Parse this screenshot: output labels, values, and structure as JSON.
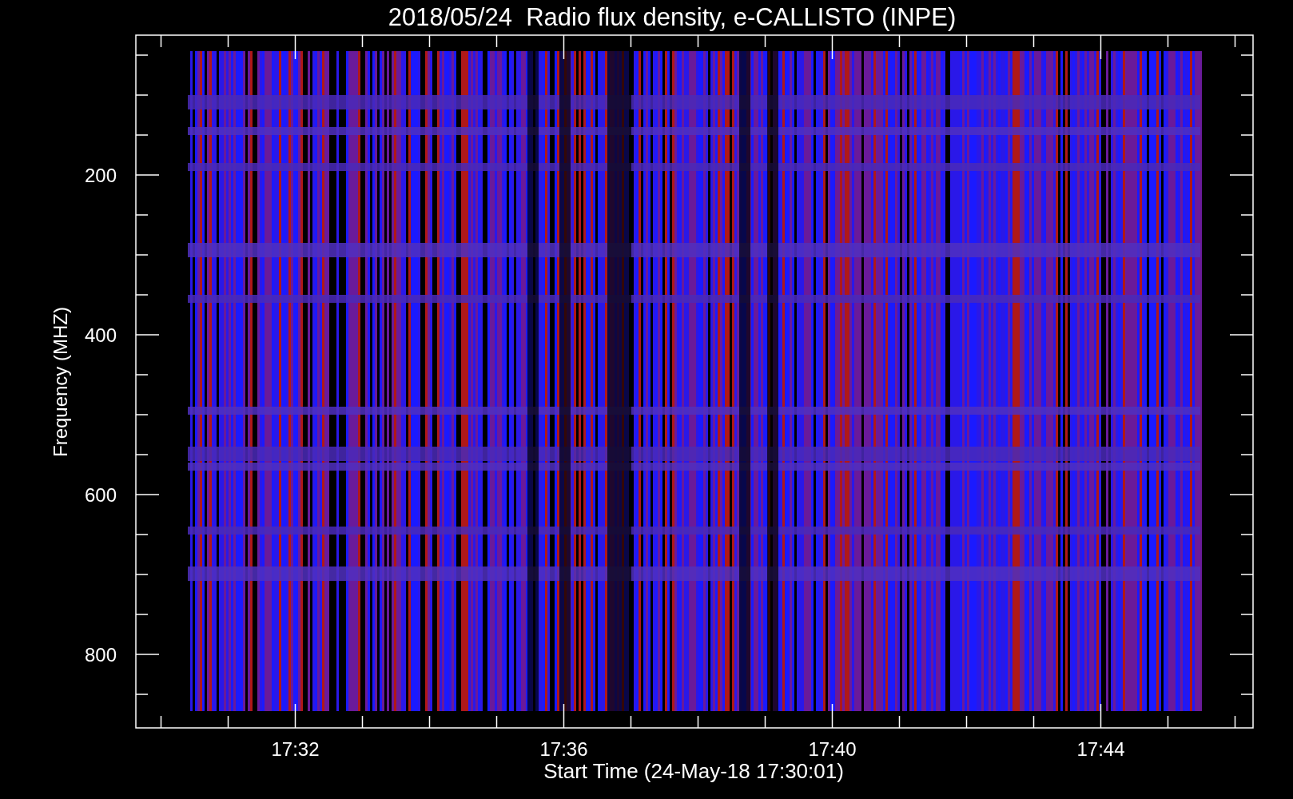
{
  "title": "2018/05/24  Radio flux density, e-CALLISTO (INPE)",
  "y_axis": {
    "label": "Frequency (MHZ)",
    "ticks": [
      "200",
      "400",
      "600",
      "800"
    ]
  },
  "x_axis": {
    "label": "Start Time (24-May-18 17:30:01)",
    "ticks": [
      "17:32",
      "17:36",
      "17:40",
      "17:44"
    ]
  }
}
